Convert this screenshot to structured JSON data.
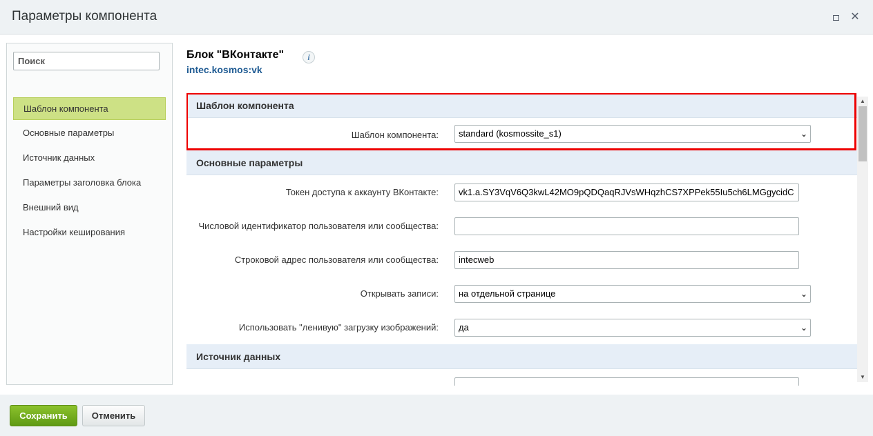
{
  "window": {
    "title": "Параметры компонента",
    "maximize_icon": "maximize-icon",
    "close_icon": "close-icon",
    "close_glyph": "✕"
  },
  "sidebar": {
    "search_placeholder": "Поиск",
    "items": [
      {
        "label": "Шаблон компонента",
        "active": true
      },
      {
        "label": "Основные параметры",
        "active": false
      },
      {
        "label": "Источник данных",
        "active": false
      },
      {
        "label": "Параметры заголовка блока",
        "active": false
      },
      {
        "label": "Внешний вид",
        "active": false
      },
      {
        "label": "Настройки кеширования",
        "active": false
      }
    ]
  },
  "component": {
    "title": "Блок \"ВКонтакте\"",
    "info_glyph": "i",
    "code": "intec.kosmos:vk"
  },
  "sections": {
    "template": {
      "heading": "Шаблон компонента",
      "template_label": "Шаблон компонента:",
      "template_value": "standard (kosmossite_s1)"
    },
    "main": {
      "heading": "Основные параметры",
      "token_label": "Токен доступа к аккаунту ВКонтакте:",
      "token_value": "vk1.a.SY3VqV6Q3kwL42MO9pQDQaqRJVsWHqzhCS7XPPek55Iu5ch6LMGgycidC",
      "user_id_label": "Числовой идентификатор пользователя или сообщества:",
      "user_id_value": "",
      "address_label": "Строковой адрес пользователя или сообщества:",
      "address_value": "intecweb",
      "open_label": "Открывать записи:",
      "open_value": "на отдельной странице",
      "lazy_label": "Использовать \"ленивую\" загрузку изображений:",
      "lazy_value": "да"
    },
    "source": {
      "heading": "Источник данных"
    }
  },
  "footer": {
    "save_label": "Сохранить",
    "cancel_label": "Отменить"
  },
  "colors": {
    "highlight": "#e00000",
    "active_item": "#cde185",
    "save_button": "#7ab320",
    "section_bg": "#e6eef7"
  }
}
